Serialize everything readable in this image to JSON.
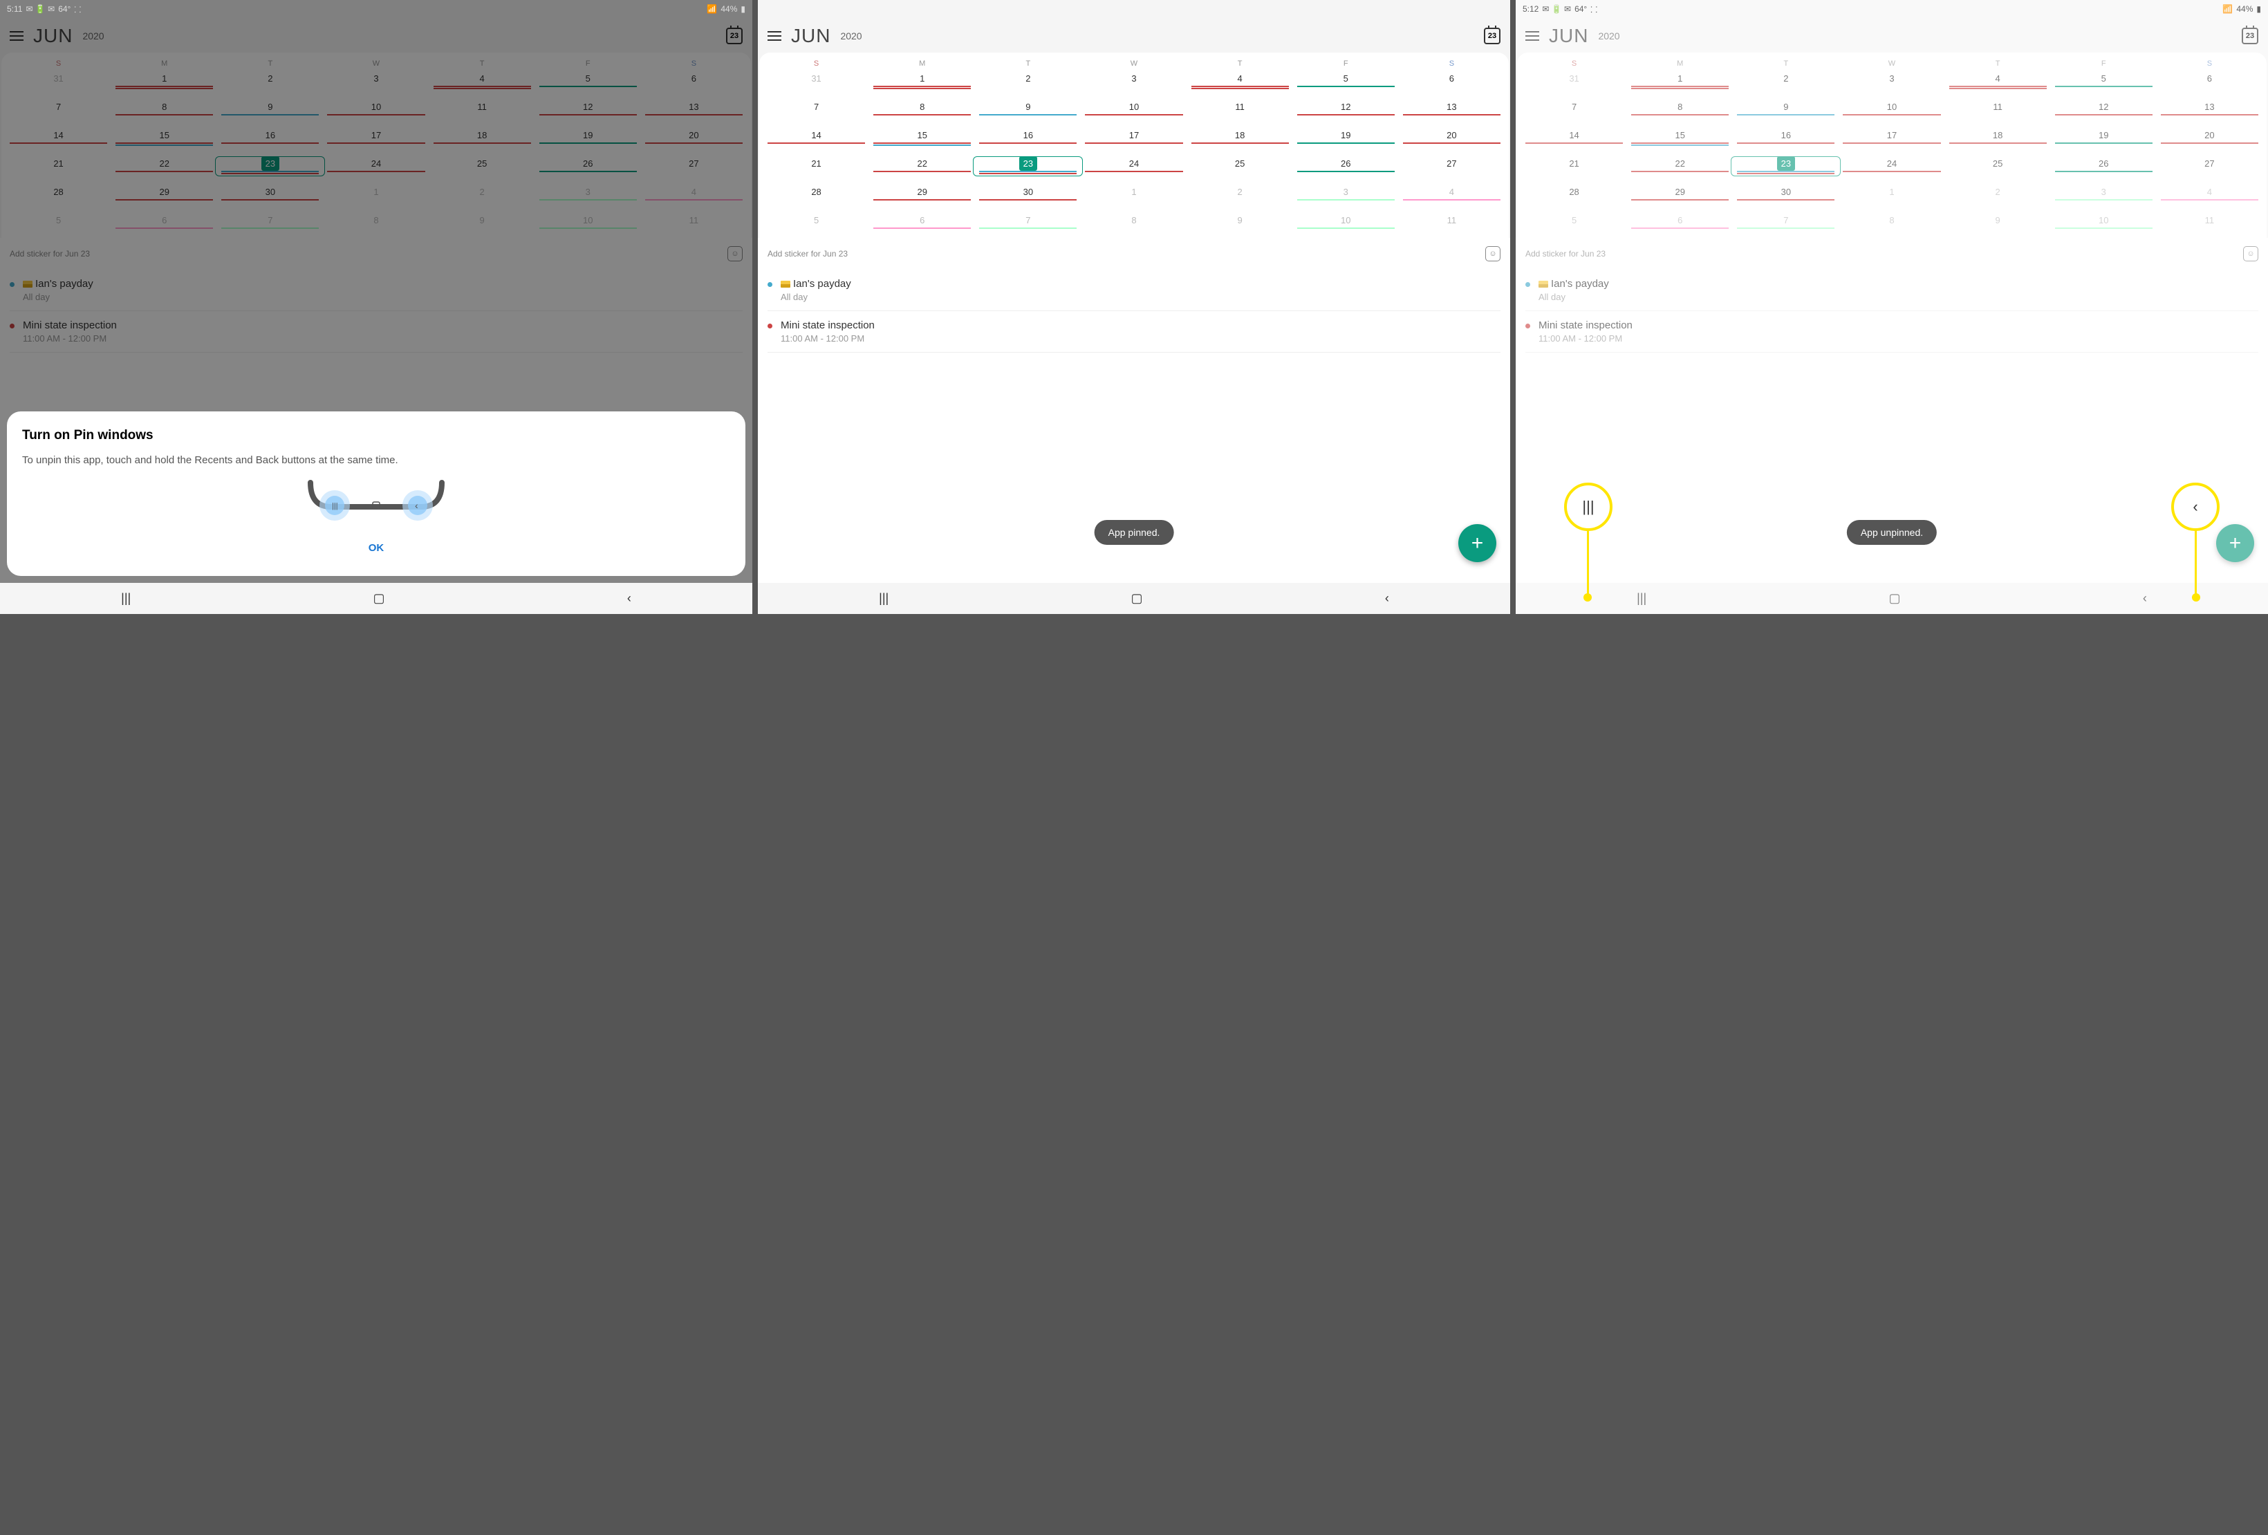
{
  "status": {
    "time1": "5:11",
    "time3": "5:12",
    "temp": "64°",
    "battery": "44%"
  },
  "header": {
    "month": "JUN",
    "year": "2020",
    "calday": "23"
  },
  "dow": [
    "S",
    "M",
    "T",
    "W",
    "T",
    "F",
    "S"
  ],
  "weeks": [
    [
      {
        "n": "31",
        "out": 1
      },
      {
        "n": "1",
        "l": [
          "r",
          "r"
        ]
      },
      {
        "n": "2"
      },
      {
        "n": "3"
      },
      {
        "n": "4",
        "l": [
          "r",
          "r"
        ]
      },
      {
        "n": "5",
        "l": [
          "g"
        ]
      },
      {
        "n": "6"
      }
    ],
    [
      {
        "n": "7"
      },
      {
        "n": "8",
        "l": [
          "r"
        ]
      },
      {
        "n": "9",
        "l": [
          "b"
        ]
      },
      {
        "n": "10",
        "l": [
          "r"
        ]
      },
      {
        "n": "11"
      },
      {
        "n": "12",
        "l": [
          "r"
        ]
      },
      {
        "n": "13",
        "l": [
          "r"
        ]
      }
    ],
    [
      {
        "n": "14",
        "l": [
          "r"
        ]
      },
      {
        "n": "15",
        "l": [
          "r",
          "b"
        ]
      },
      {
        "n": "16",
        "l": [
          "r"
        ]
      },
      {
        "n": "17",
        "l": [
          "r"
        ]
      },
      {
        "n": "18",
        "l": [
          "r"
        ]
      },
      {
        "n": "19",
        "l": [
          "g"
        ]
      },
      {
        "n": "20",
        "l": [
          "r"
        ]
      }
    ],
    [
      {
        "n": "21"
      },
      {
        "n": "22",
        "l": [
          "r"
        ]
      },
      {
        "n": "23",
        "sel": 1,
        "box": 1,
        "l": [
          "b",
          "r"
        ]
      },
      {
        "n": "24",
        "l": [
          "r"
        ]
      },
      {
        "n": "25"
      },
      {
        "n": "26",
        "l": [
          "g"
        ]
      },
      {
        "n": "27"
      }
    ],
    [
      {
        "n": "28"
      },
      {
        "n": "29",
        "l": [
          "r"
        ]
      },
      {
        "n": "30",
        "l": [
          "r"
        ]
      },
      {
        "n": "1",
        "out": 1
      },
      {
        "n": "2",
        "out": 1
      },
      {
        "n": "3",
        "out": 1,
        "l": [
          "lg"
        ]
      },
      {
        "n": "4",
        "out": 1,
        "l": [
          "lr"
        ]
      }
    ],
    [
      {
        "n": "5",
        "out": 1
      },
      {
        "n": "6",
        "out": 1,
        "l": [
          "lr"
        ]
      },
      {
        "n": "7",
        "out": 1,
        "l": [
          "lg"
        ]
      },
      {
        "n": "8",
        "out": 1
      },
      {
        "n": "9",
        "out": 1
      },
      {
        "n": "10",
        "out": 1,
        "l": [
          "lg"
        ]
      },
      {
        "n": "11",
        "out": 1
      }
    ]
  ],
  "sticker": "Add sticker for Jun 23",
  "events": [
    {
      "dot": "c1",
      "title": "Ian's payday",
      "time": "All day",
      "cc": 1
    },
    {
      "dot": "c2",
      "title": "Mini state inspection",
      "time": "11:00 AM - 12:00 PM"
    }
  ],
  "dialog": {
    "title": "Turn on Pin windows",
    "body": "To unpin this app, touch and hold the Recents and Back buttons at the same time.",
    "ok": "OK"
  },
  "toast1": "App pinned.",
  "toast2": "App unpinned."
}
